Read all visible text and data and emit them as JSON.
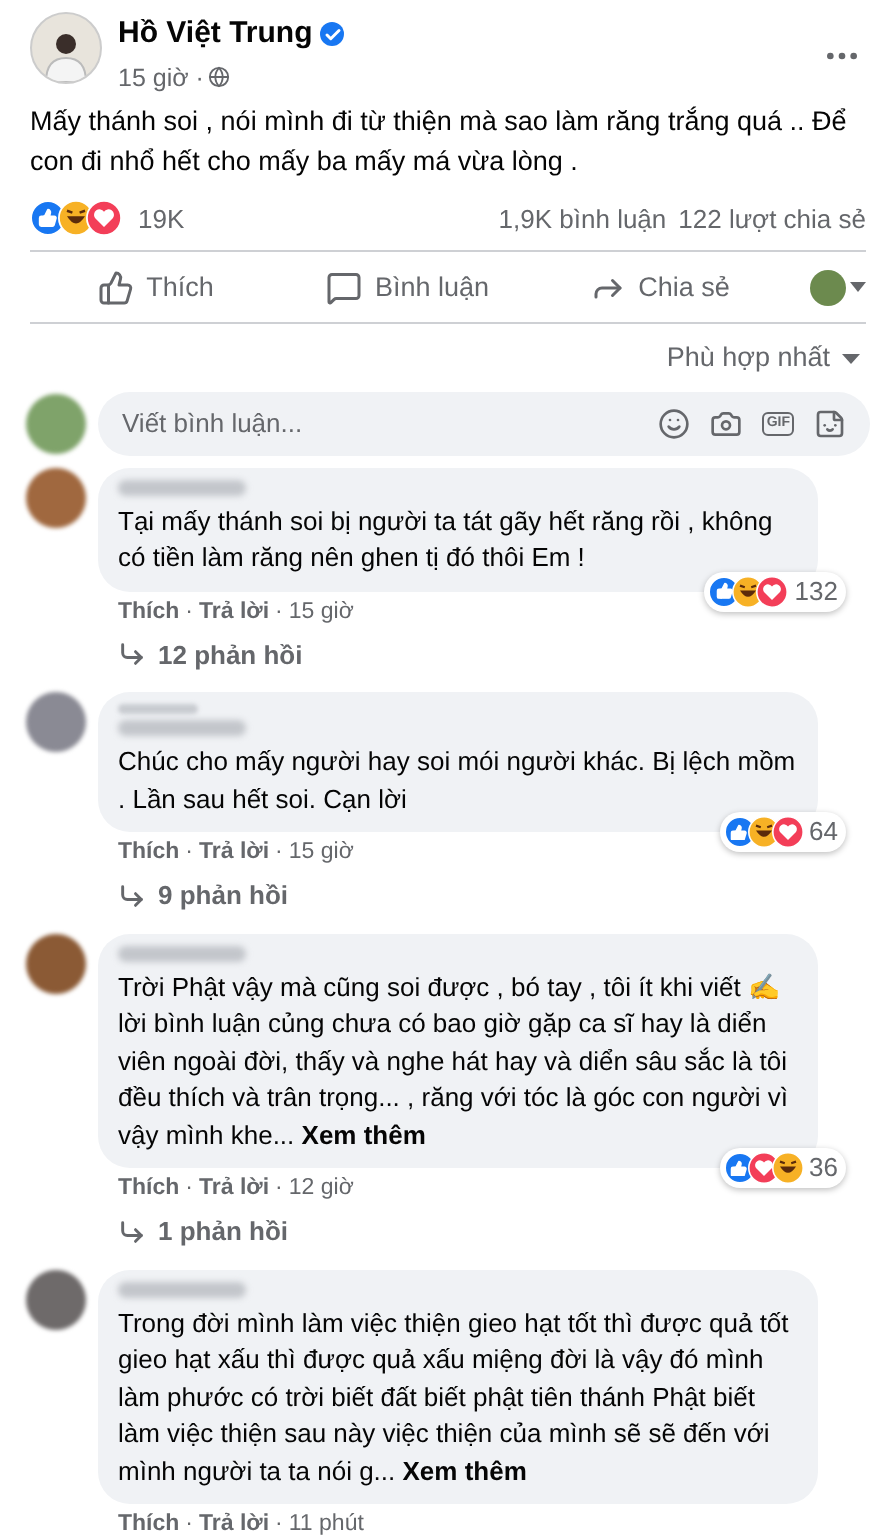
{
  "post": {
    "author": "Hồ Việt Trung",
    "verified": true,
    "time": "15 giờ ·",
    "text": "Mấy thánh soi , nói mình đi từ thiện mà sao làm răng trắng quá .. Để con đi nhổ hết cho mấy ba mấy má vừa lòng .",
    "reactions": [
      {
        "kind": "like"
      },
      {
        "kind": "haha"
      },
      {
        "kind": "love"
      }
    ],
    "reaction_count": "19K",
    "comments_count": "1,9K bình luận",
    "shares_count": "122 lượt chia sẻ"
  },
  "actions": [
    "Thích",
    "Bình luận",
    "Chia sẻ"
  ],
  "sort": "Phù hợp nhất",
  "comment_box": {
    "placeholder": "Viết bình luận...",
    "gif_label": "GIF"
  },
  "comments": [
    {
      "name_badge": false,
      "text": "Tại mấy thánh soi bị người ta tát gãy hết răng rồi , không có tiền làm răng nên ghen tị đó thôi Em !",
      "reactions": [
        {
          "kind": "like"
        },
        {
          "kind": "haha"
        },
        {
          "kind": "love"
        }
      ],
      "reaction_count": "132",
      "meta": [
        {
          "kind": "link",
          "text": "Thích"
        },
        {
          "kind": "sep",
          "text": "·"
        },
        {
          "kind": "link",
          "text": "Trả lời"
        },
        {
          "kind": "sep",
          "text": "·"
        },
        {
          "kind": "time",
          "text": "15 giờ"
        }
      ],
      "replies": "12 phản hồi"
    },
    {
      "name_badge": true,
      "text": "Chúc cho mấy người hay soi mói người khác. Bị lệch mồm . Lần sau hết soi. Cạn lời",
      "reactions": [
        {
          "kind": "like"
        },
        {
          "kind": "haha"
        },
        {
          "kind": "love"
        }
      ],
      "reaction_count": "64",
      "meta": [
        {
          "kind": "link",
          "text": "Thích"
        },
        {
          "kind": "sep",
          "text": "·"
        },
        {
          "kind": "link",
          "text": "Trả lời"
        },
        {
          "kind": "sep",
          "text": "·"
        },
        {
          "kind": "time",
          "text": "15 giờ"
        }
      ],
      "replies": "9 phản hồi"
    },
    {
      "name_badge": false,
      "text": "Trời Phật vậy mà cũng soi được , bó tay , tôi ít khi viết ✍ lời bình luận củng chưa có bao giờ gặp ca sĩ hay là diển viên ngoài đời, thấy và nghe hát hay và diển sâu sắc là tôi đều thích và trân trọng... , răng với tóc là góc con người vì vậy mình khe...",
      "see_more": "Xem thêm",
      "reactions": [
        {
          "kind": "like"
        },
        {
          "kind": "love"
        },
        {
          "kind": "haha"
        }
      ],
      "reaction_count": "36",
      "meta": [
        {
          "kind": "link",
          "text": "Thích"
        },
        {
          "kind": "sep",
          "text": "·"
        },
        {
          "kind": "link",
          "text": "Trả lời"
        },
        {
          "kind": "sep",
          "text": "·"
        },
        {
          "kind": "time",
          "text": "12 giờ"
        }
      ],
      "replies": "1 phản hồi"
    },
    {
      "name_badge": false,
      "text": "Trong đời mình làm việc thiện gieo hạt tốt thì được quả tốt gieo hạt xấu thì được quả xấu miệng đời là vậy đó mình làm phước có trời biết đất biết phật tiên thánh Phật biết làm việc thiện sau này việc thiện của mình sẽ sẽ đến với mình người ta ta nói g...",
      "see_more": "Xem thêm",
      "meta": [
        {
          "kind": "link",
          "text": "Thích"
        },
        {
          "kind": "sep",
          "text": "·"
        },
        {
          "kind": "link",
          "text": "Trả lời"
        },
        {
          "kind": "sep",
          "text": "·"
        },
        {
          "kind": "time",
          "text": "11 phút"
        }
      ]
    }
  ]
}
